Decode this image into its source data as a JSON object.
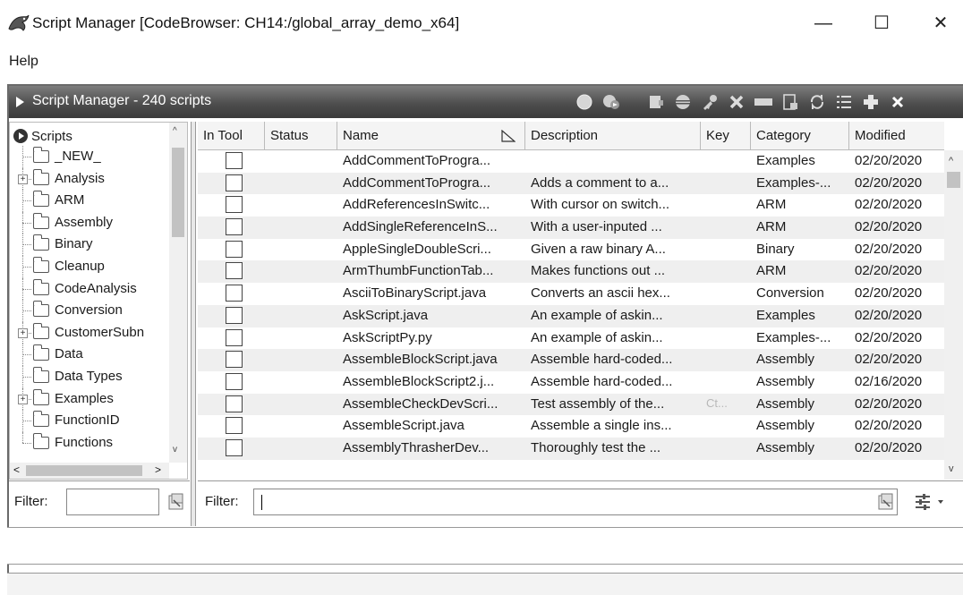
{
  "window": {
    "title": "Script Manager [CodeBrowser: CH14:/global_array_demo_x64]",
    "min_glyph": "—",
    "max_glyph": "☐",
    "close_glyph": "✕"
  },
  "menu": {
    "help_label": "Help"
  },
  "panel": {
    "title": "Script Manager - 240 scripts",
    "toolbar_icons": [
      "run-script-icon",
      "run-last-script-icon",
      "edit-script-icon",
      "eclipse-icon",
      "key-bindings-icon",
      "delete-script-icon",
      "rename-script-icon",
      "new-script-icon",
      "refresh-icon",
      "script-directories-icon",
      "create-new-script-icon",
      "close-panel-icon"
    ]
  },
  "tree": {
    "root_label": "Scripts",
    "items": [
      {
        "label": "_NEW_",
        "expandable": false
      },
      {
        "label": "Analysis",
        "expandable": true
      },
      {
        "label": "ARM",
        "expandable": false
      },
      {
        "label": "Assembly",
        "expandable": false
      },
      {
        "label": "Binary",
        "expandable": false
      },
      {
        "label": "Cleanup",
        "expandable": false
      },
      {
        "label": "CodeAnalysis",
        "expandable": false
      },
      {
        "label": "Conversion",
        "expandable": false
      },
      {
        "label": "CustomerSubn",
        "expandable": true
      },
      {
        "label": "Data",
        "expandable": false
      },
      {
        "label": "Data Types",
        "expandable": false
      },
      {
        "label": "Examples",
        "expandable": true
      },
      {
        "label": "FunctionID",
        "expandable": false
      },
      {
        "label": "Functions",
        "expandable": false
      }
    ],
    "up_glyph": "^",
    "down_glyph": "v",
    "left_glyph": "<",
    "right_glyph": ">"
  },
  "table": {
    "headers": [
      "In Tool",
      "Status",
      "Name",
      "Description",
      "Key",
      "Category",
      "Modified"
    ],
    "rows": [
      {
        "name": "AddCommentToProgra...",
        "description": "",
        "key": "",
        "category": "Examples",
        "modified": "02/20/2020"
      },
      {
        "name": "AddCommentToProgra...",
        "description": "Adds a comment to a...",
        "key": "",
        "category": "Examples-...",
        "modified": "02/20/2020"
      },
      {
        "name": "AddReferencesInSwitc...",
        "description": "With cursor on switch...",
        "key": "",
        "category": "ARM",
        "modified": "02/20/2020"
      },
      {
        "name": "AddSingleReferenceInS...",
        "description": "With a user-inputed ...",
        "key": "",
        "category": "ARM",
        "modified": "02/20/2020"
      },
      {
        "name": "AppleSingleDoubleScri...",
        "description": "Given a raw binary A...",
        "key": "",
        "category": "Binary",
        "modified": "02/20/2020"
      },
      {
        "name": "ArmThumbFunctionTab...",
        "description": "Makes functions out ...",
        "key": "",
        "category": "ARM",
        "modified": "02/20/2020"
      },
      {
        "name": "AsciiToBinaryScript.java",
        "description": "Converts an ascii hex...",
        "key": "",
        "category": "Conversion",
        "modified": "02/20/2020"
      },
      {
        "name": "AskScript.java",
        "description": "An example of askin...",
        "key": "",
        "category": "Examples",
        "modified": "02/20/2020"
      },
      {
        "name": "AskScriptPy.py",
        "description": "An example of askin...",
        "key": "",
        "category": "Examples-...",
        "modified": "02/20/2020"
      },
      {
        "name": "AssembleBlockScript.java",
        "description": "Assemble hard-coded...",
        "key": "",
        "category": "Assembly",
        "modified": "02/20/2020"
      },
      {
        "name": "AssembleBlockScript2.j...",
        "description": "Assemble hard-coded...",
        "key": "",
        "category": "Assembly",
        "modified": "02/16/2020"
      },
      {
        "name": "AssembleCheckDevScri...",
        "description": "Test assembly of the...",
        "key": "Ct...",
        "category": "Assembly",
        "modified": "02/20/2020"
      },
      {
        "name": "AssembleScript.java",
        "description": "Assemble a single ins...",
        "key": "",
        "category": "Assembly",
        "modified": "02/20/2020"
      },
      {
        "name": "AssemblyThrasherDev...",
        "description": "Thoroughly test the ...",
        "key": "",
        "category": "Assembly",
        "modified": "02/20/2020"
      }
    ],
    "up_glyph": "^",
    "down_glyph": "v"
  },
  "filters": {
    "left_label": "Filter:",
    "left_value": "",
    "right_label": "Filter:",
    "right_value": ""
  }
}
